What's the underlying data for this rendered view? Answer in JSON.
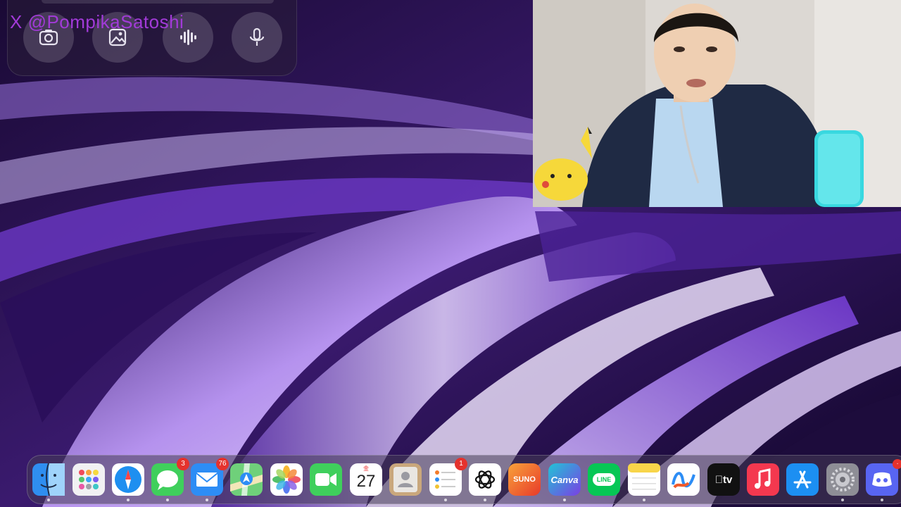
{
  "watermark": "X @PompikaSatoshi",
  "chat_panel": {
    "tools": [
      {
        "name": "camera-icon"
      },
      {
        "name": "image-icon"
      },
      {
        "name": "voice-wave-icon"
      },
      {
        "name": "microphone-icon"
      }
    ]
  },
  "webcam": {
    "description_icon": "webcam-person-icon"
  },
  "dock": {
    "apps": [
      {
        "name": "finder-icon",
        "badge": null
      },
      {
        "name": "launchpad-icon",
        "badge": null
      },
      {
        "name": "safari-icon",
        "badge": null
      },
      {
        "name": "messages-icon",
        "badge": "3"
      },
      {
        "name": "mail-icon",
        "badge": "76"
      },
      {
        "name": "maps-icon",
        "badge": null
      },
      {
        "name": "photos-icon",
        "badge": null
      },
      {
        "name": "facetime-icon",
        "badge": null
      },
      {
        "name": "calendar-icon",
        "badge": null,
        "day": "金",
        "date": "27"
      },
      {
        "name": "contacts-icon",
        "badge": null
      },
      {
        "name": "reminders-icon",
        "badge": "1"
      },
      {
        "name": "chatgpt-icon",
        "badge": null
      },
      {
        "name": "suno-icon",
        "badge": null,
        "label": "SUNO"
      },
      {
        "name": "canva-icon",
        "badge": null,
        "label": "Canva"
      },
      {
        "name": "line-icon",
        "badge": null,
        "label": "LINE"
      },
      {
        "name": "notes-icon",
        "badge": null
      },
      {
        "name": "freeform-icon",
        "badge": null
      },
      {
        "name": "apple-tv-icon",
        "badge": null,
        "label": "tv"
      },
      {
        "name": "music-icon",
        "badge": null
      },
      {
        "name": "app-store-icon",
        "badge": null
      },
      {
        "name": "system-settings-icon",
        "badge": null
      },
      {
        "name": "discord-icon",
        "badge": "·"
      }
    ]
  },
  "colors": {
    "accent": "#7b3fd0",
    "badge": "#e5322d"
  }
}
